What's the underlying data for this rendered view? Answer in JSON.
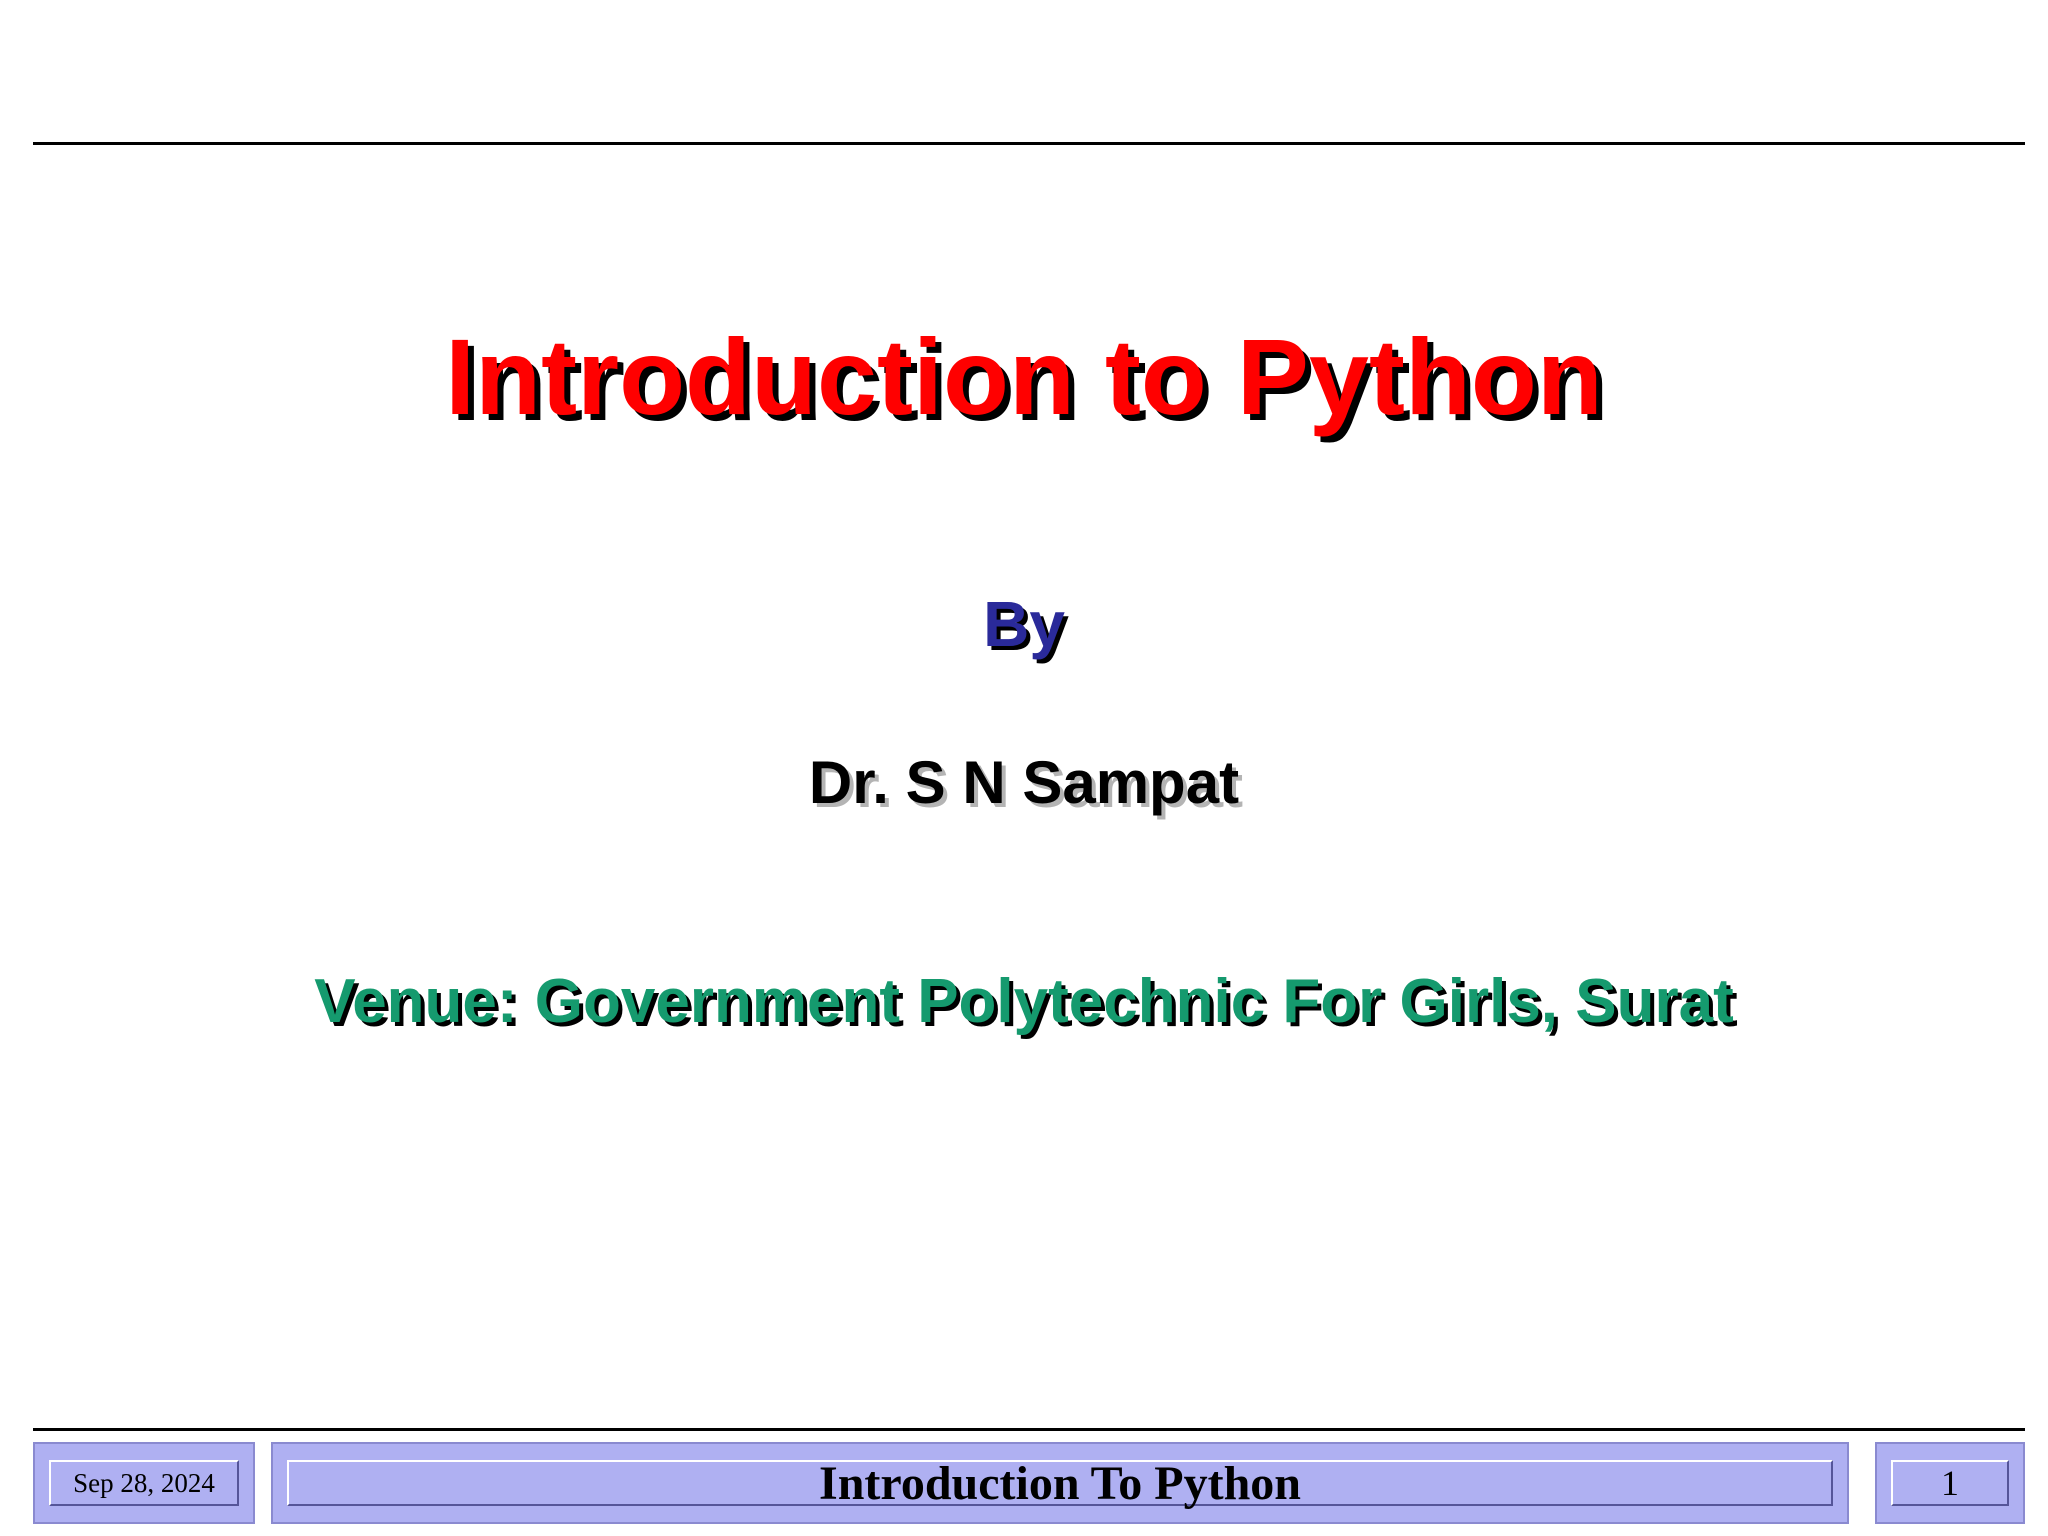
{
  "slide": {
    "title": "Introduction to Python",
    "by_label": "By",
    "author": "Dr. S N Sampat",
    "venue": "Venue: Government Polytechnic For Girls, Surat"
  },
  "footer": {
    "date": "Sep 28, 2024",
    "title": "Introduction To Python",
    "page_number": "1"
  },
  "colors": {
    "title": "#ff0000",
    "by": "#2a2a9a",
    "author": "#000000",
    "venue": "#159a6e",
    "footer_bg": "#afb0f2"
  }
}
